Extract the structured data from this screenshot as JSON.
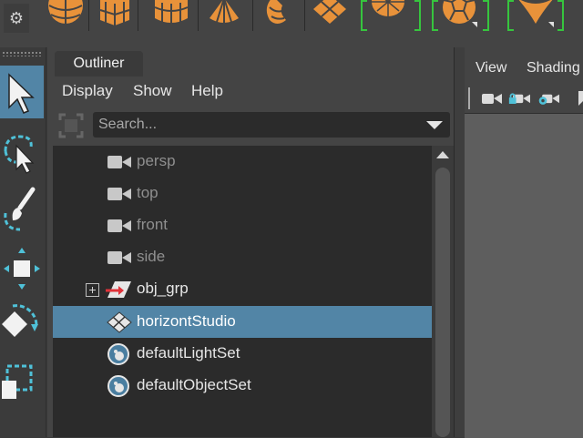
{
  "shelf": {
    "settings_icon": "gear-icon",
    "icons": [
      "sphere-icon",
      "cube-icon",
      "cylinder-icon",
      "cone-icon",
      "torus-icon",
      "plane-icon",
      "disc-icon",
      "soccer-ball-icon",
      "superellipse-icon"
    ],
    "icon_color": "#e8923a",
    "accent_green": "#36c53e"
  },
  "toolbox": {
    "tools": [
      "select-tool",
      "lasso-tool",
      "paint-select-tool",
      "move-tool",
      "rotate-tool",
      "scale-tool"
    ],
    "active_tool": "select-tool",
    "accent": "#5285a6"
  },
  "outliner": {
    "tab_label": "Outliner",
    "menus": [
      "Display",
      "Show",
      "Help"
    ],
    "search_placeholder": "Search...",
    "items": [
      {
        "label": "persp",
        "icon": "camera-icon",
        "kind": "camera"
      },
      {
        "label": "top",
        "icon": "camera-icon",
        "kind": "camera"
      },
      {
        "label": "front",
        "icon": "camera-icon",
        "kind": "camera"
      },
      {
        "label": "side",
        "icon": "camera-icon",
        "kind": "camera"
      },
      {
        "label": "obj_grp",
        "icon": "group-icon",
        "kind": "group",
        "expandable": true
      },
      {
        "label": "horizontStudio",
        "icon": "mesh-icon",
        "kind": "mesh",
        "selected": true
      },
      {
        "label": "defaultLightSet",
        "icon": "set-icon",
        "kind": "set"
      },
      {
        "label": "defaultObjectSet",
        "icon": "set-icon",
        "kind": "set"
      }
    ],
    "selected_color": "#5285a6"
  },
  "viewport": {
    "menus": [
      "View",
      "Shading"
    ]
  }
}
